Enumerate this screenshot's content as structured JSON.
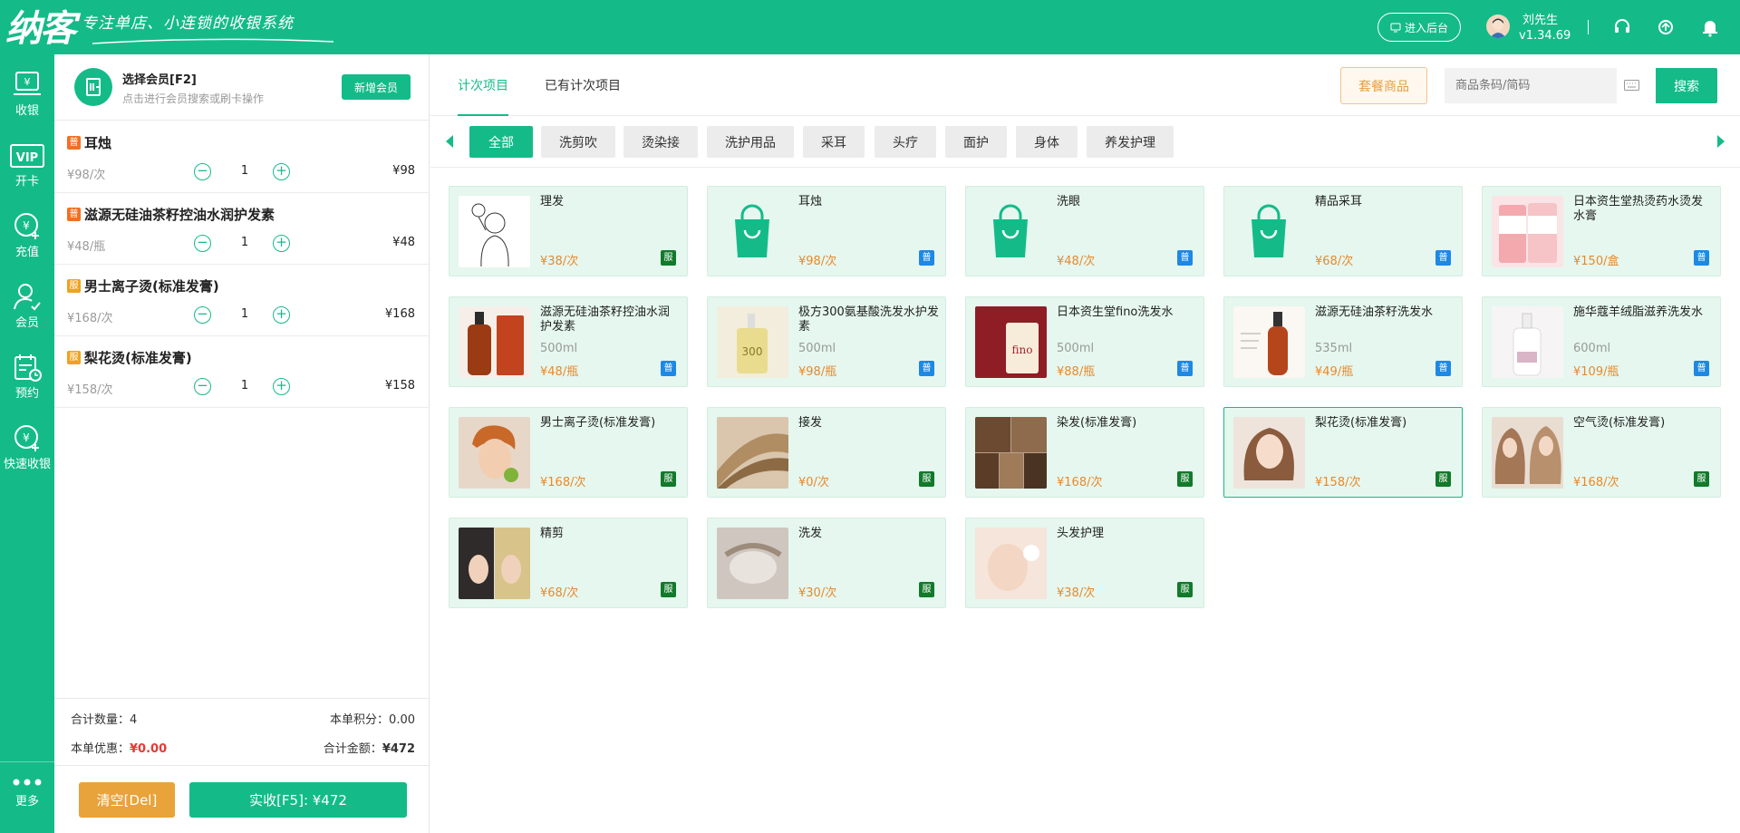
{
  "brand": {
    "logo": "纳客",
    "slogan": "专注单店、小连锁的收银系统"
  },
  "header": {
    "backend_btn": "进入后台",
    "user_name": "刘先生",
    "version": "v1.34.69"
  },
  "sidebar": {
    "items": [
      {
        "label": "收银",
        "icon": "cashier-icon"
      },
      {
        "label": "开卡",
        "icon": "vip-card-icon"
      },
      {
        "label": "充值",
        "icon": "recharge-icon"
      },
      {
        "label": "会员",
        "icon": "member-icon"
      },
      {
        "label": "预约",
        "icon": "appointment-icon"
      },
      {
        "label": "快速收银",
        "icon": "quick-cashier-icon"
      }
    ],
    "more": "更多"
  },
  "member": {
    "title": "选择会员[F2]",
    "subtitle": "点击进行会员搜索或刷卡操作",
    "new_btn": "新增会员"
  },
  "cart": {
    "items": [
      {
        "badge": "普",
        "name": "耳烛",
        "unit_price": "¥98/次",
        "qty": "1",
        "total": "¥98"
      },
      {
        "badge": "普",
        "name": "滋源无硅油茶籽控油水润护发素",
        "unit_price": "¥48/瓶",
        "qty": "1",
        "total": "¥48"
      },
      {
        "badge": "服",
        "name": "男士离子烫(标准发膏)",
        "unit_price": "¥168/次",
        "qty": "1",
        "total": "¥168"
      },
      {
        "badge": "服",
        "name": "梨花烫(标准发膏)",
        "unit_price": "¥158/次",
        "qty": "1",
        "total": "¥158"
      }
    ]
  },
  "summary": {
    "count_label": "合计数量：",
    "count": "4",
    "points_label": "本单积分：",
    "points": "0.00",
    "discount_label": "本单优惠：",
    "discount": "¥0.00",
    "amount_label": "合计金额：",
    "amount": "¥472"
  },
  "actions": {
    "clear": "清空[Del]",
    "pay": "实收[F5]: ¥472"
  },
  "tabs": [
    {
      "label": "计次项目",
      "active": true
    },
    {
      "label": "已有计次项目",
      "active": false
    }
  ],
  "package_btn": "套餐商品",
  "search": {
    "placeholder": "商品条码/简码",
    "button": "搜索"
  },
  "categories": [
    "全部",
    "洗剪吹",
    "烫染接",
    "洗护用品",
    "采耳",
    "头疗",
    "面护",
    "身体",
    "养发护理"
  ],
  "products": [
    {
      "name": "理发",
      "spec": "",
      "price": "¥38/次",
      "badge": "服"
    },
    {
      "name": "耳烛",
      "spec": "",
      "price": "¥98/次",
      "badge": "普"
    },
    {
      "name": "洗眼",
      "spec": "",
      "price": "¥48/次",
      "badge": "普"
    },
    {
      "name": "精品采耳",
      "spec": "",
      "price": "¥68/次",
      "badge": "普"
    },
    {
      "name": "日本资生堂热烫药水烫发水膏",
      "spec": "",
      "price": "¥150/盒",
      "badge": "普"
    },
    {
      "name": "滋源无硅油茶籽控油水润护发素",
      "spec": "500ml",
      "price": "¥48/瓶",
      "badge": "普"
    },
    {
      "name": "极方300氨基酸洗发水护发素",
      "spec": "500ml",
      "price": "¥98/瓶",
      "badge": "普"
    },
    {
      "name": "日本资生堂fino洗发水",
      "spec": "500ml",
      "price": "¥88/瓶",
      "badge": "普"
    },
    {
      "name": "滋源无硅油茶籽洗发水",
      "spec": "535ml",
      "price": "¥49/瓶",
      "badge": "普"
    },
    {
      "name": "施华蔻羊绒脂滋养洗发水",
      "spec": "600ml",
      "price": "¥109/瓶",
      "badge": "普"
    },
    {
      "name": "男士离子烫(标准发膏)",
      "spec": "",
      "price": "¥168/次",
      "badge": "服"
    },
    {
      "name": "接发",
      "spec": "",
      "price": "¥0/次",
      "badge": "服"
    },
    {
      "name": "染发(标准发膏)",
      "spec": "",
      "price": "¥168/次",
      "badge": "服"
    },
    {
      "name": "梨花烫(标准发膏)",
      "spec": "",
      "price": "¥158/次",
      "badge": "服",
      "selected": true
    },
    {
      "name": "空气烫(标准发膏)",
      "spec": "",
      "price": "¥168/次",
      "badge": "服"
    },
    {
      "name": "精剪",
      "spec": "",
      "price": "¥68/次",
      "badge": "服"
    },
    {
      "name": "洗发",
      "spec": "",
      "price": "¥30/次",
      "badge": "服"
    },
    {
      "name": "头发护理",
      "spec": "",
      "price": "¥38/次",
      "badge": "服"
    }
  ],
  "colors": {
    "brand": "#14bb88",
    "price": "#e8892b",
    "badge_pu": "#1e88e5",
    "badge_fu": "#127a2a",
    "clear_btn": "#e8a33a",
    "discount": "#e53935"
  }
}
